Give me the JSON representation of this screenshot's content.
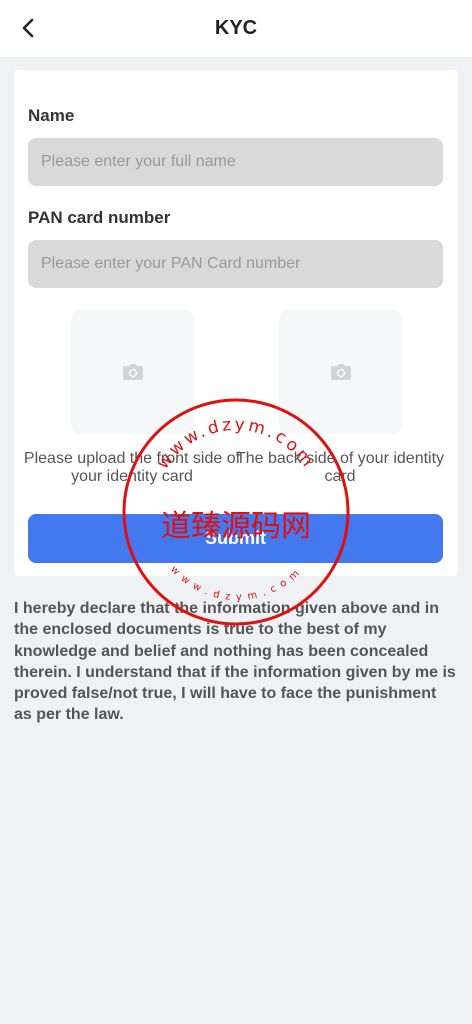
{
  "header": {
    "title": "KYC",
    "back_icon": "chevron-left-icon"
  },
  "form": {
    "name_label": "Name",
    "name_placeholder": "Please enter your full name",
    "name_value": "",
    "pan_label": "PAN card number",
    "pan_placeholder": "Please enter your PAN Card number",
    "pan_value": "",
    "upload_front_icon": "camera-icon",
    "upload_front_caption": "Please upload the front side of your identity card",
    "upload_back_icon": "camera-icon",
    "upload_back_caption": "The back side of your identity card",
    "submit_label": "Submit"
  },
  "declaration": "I hereby declare that the information given above and in the enclosed documents is true to the best of my knowledge and belief and nothing has been concealed therein. I understand that if the information given by me is proved false/not true, I will have to face the punishment as per the law.",
  "watermark": {
    "text_cn": "道臻源码网",
    "ring_top": "www.dzym.com",
    "ring_bottom": "www.dzym.com",
    "color": "#e01010"
  },
  "colors": {
    "primary": "#4478ee",
    "background": "#f0f1f5",
    "input_bg": "#d9d9d9"
  }
}
